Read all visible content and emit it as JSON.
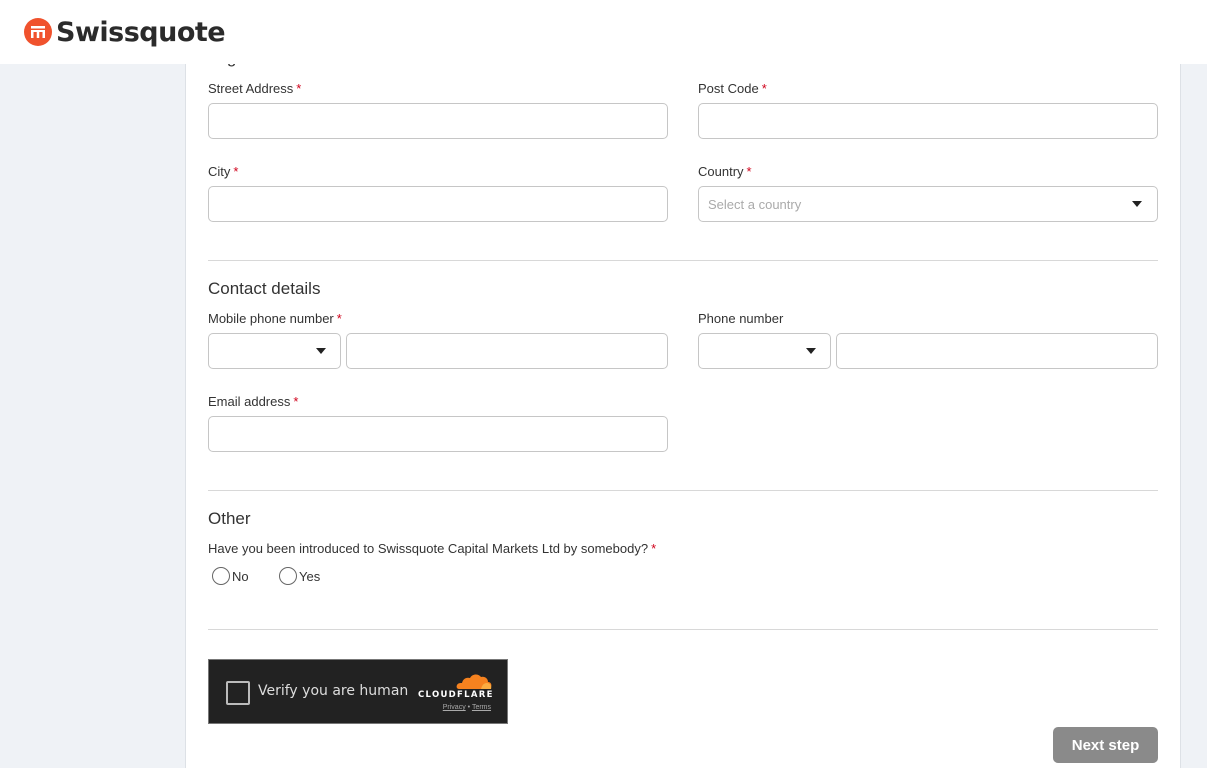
{
  "brand": {
    "name": "Swissquote",
    "accent": "#f0522d"
  },
  "legal_address": {
    "title": "Legal address",
    "street": {
      "label": "Street Address",
      "required": "*",
      "value": ""
    },
    "post_code": {
      "label": "Post Code",
      "required": "*",
      "value": ""
    },
    "city": {
      "label": "City",
      "required": "*",
      "value": ""
    },
    "country": {
      "label": "Country",
      "required": "*",
      "placeholder": "Select a country"
    }
  },
  "contact": {
    "title": "Contact details",
    "mobile": {
      "label": "Mobile phone number",
      "required": "*",
      "prefix": "",
      "value": ""
    },
    "phone": {
      "label": "Phone number",
      "prefix": "",
      "value": ""
    },
    "email": {
      "label": "Email address",
      "required": "*",
      "value": ""
    }
  },
  "other": {
    "title": "Other",
    "question": "Have you been introduced to Swissquote Capital Markets Ltd by somebody?",
    "required": "*",
    "options": [
      "No",
      "Yes"
    ]
  },
  "captcha": {
    "text": "Verify you are human",
    "brand": "CLOUDFLARE",
    "privacy": "Privacy",
    "separator": "•",
    "terms": "Terms"
  },
  "actions": {
    "next_label": "Next step"
  }
}
